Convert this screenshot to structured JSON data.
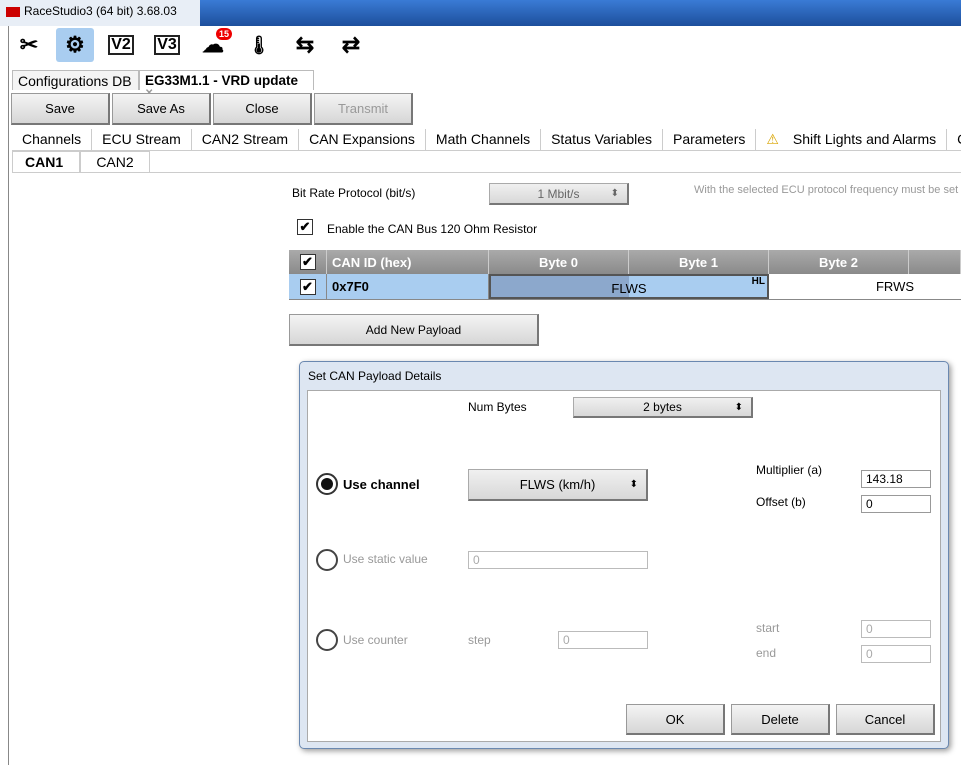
{
  "window": {
    "title": "RaceStudio3 (64 bit) 3.68.03"
  },
  "toolbar": {
    "items": [
      {
        "name": "tools",
        "glyph": "✂"
      },
      {
        "name": "configuration",
        "glyph": "⚙"
      },
      {
        "name": "mychron-v2",
        "glyph": "V2"
      },
      {
        "name": "mychron-v3",
        "glyph": "V3"
      },
      {
        "name": "tracks",
        "glyph": "☁",
        "badge": "15"
      },
      {
        "name": "temperature",
        "glyph": "🌡"
      },
      {
        "name": "transfer-add",
        "glyph": "⇆"
      },
      {
        "name": "sync",
        "glyph": "⇄"
      }
    ]
  },
  "doc_tabs": [
    {
      "label": "Configurations DB"
    },
    {
      "label": "EG33M1.1 - VRD update",
      "close": "✕"
    }
  ],
  "actions": {
    "save": "Save",
    "save_as": "Save As",
    "close": "Close",
    "transmit": "Transmit"
  },
  "config_tabs": [
    "Channels",
    "ECU Stream",
    "CAN2 Stream",
    "CAN Expansions",
    "Math Channels",
    "Status Variables",
    "Parameters",
    "Shift Lights and Alarms",
    "Co"
  ],
  "can_tabs": [
    "CAN1",
    "CAN2"
  ],
  "can": {
    "bitrate_label": "Bit Rate Protocol (bit/s)",
    "bitrate_value": "1  Mbit/s",
    "note": "With the selected ECU protocol frequency must be set t",
    "resistor_label": "Enable the CAN Bus 120 Ohm Resistor",
    "resistor_checked": true
  },
  "grid": {
    "headers": [
      "CAN ID (hex)",
      "Byte 0",
      "Byte 1",
      "Byte 2"
    ],
    "rows": [
      {
        "checked": true,
        "id": "0x7F0",
        "payload1": "FLWS",
        "marker": "HL",
        "payload2": "FRWS"
      }
    ],
    "add_label": "Add New Payload"
  },
  "dialog": {
    "title": "Set CAN Payload Details",
    "num_bytes_label": "Num Bytes",
    "num_bytes_value": "2 bytes",
    "use_channel": "Use channel",
    "channel_value": "FLWS (km/h)",
    "multiplier_label": "Multiplier (a)",
    "multiplier_value": "143.18",
    "offset_label": "Offset (b)",
    "offset_value": "0",
    "use_static": "Use static value",
    "static_value": "0",
    "use_counter": "Use counter",
    "step_label": "step",
    "step_value": "0",
    "start_label": "start",
    "start_value": "0",
    "end_label": "end",
    "end_value": "0",
    "ok": "OK",
    "delete": "Delete",
    "cancel": "Cancel"
  }
}
